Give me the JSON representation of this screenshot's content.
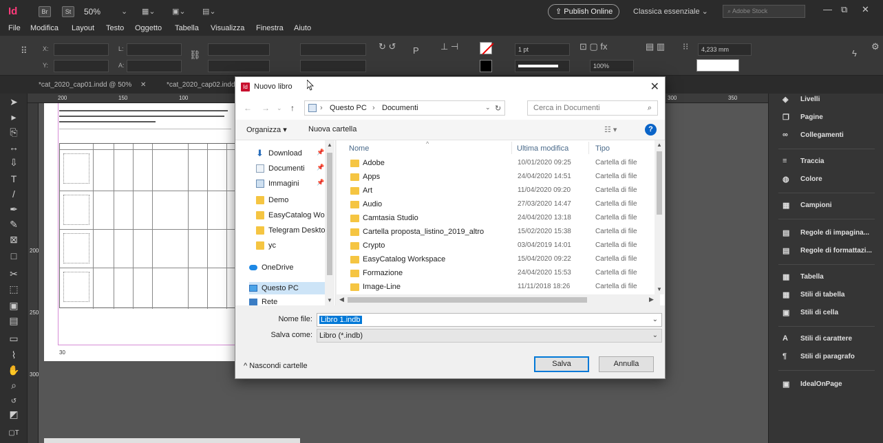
{
  "titlebar": {
    "br_label": "Br",
    "st_label": "St",
    "zoom": "50%",
    "publish_label": "Publish Online",
    "workspace": "Classica essenziale",
    "stock_placeholder": "Adobe Stock"
  },
  "menu": [
    "File",
    "Modifica",
    "Layout",
    "Testo",
    "Oggetto",
    "Tabella",
    "Visualizza",
    "Finestra",
    "Aiuto"
  ],
  "control": {
    "x_label": "X:",
    "y_label": "Y:",
    "w_label": "L:",
    "h_label": "A:",
    "stroke_weight": "1 pt",
    "zoom_percent": "100%",
    "size_value": "4,233 mm"
  },
  "doc_tabs": [
    "*cat_2020_cap01.indd @ 50%",
    "*cat_2020_cap02.indd"
  ],
  "ruler": {
    "h_ticks": [
      "200",
      "150",
      "100",
      "300",
      "350"
    ],
    "v_ticks": [
      "200",
      "250",
      "300"
    ]
  },
  "page_numbers": [
    "30"
  ],
  "right_panel": [
    {
      "label": "Livelli",
      "icon": "layers-icon"
    },
    {
      "label": "Pagine",
      "icon": "pages-icon"
    },
    {
      "label": "Collegamenti",
      "icon": "links-icon"
    },
    {
      "label": "Traccia",
      "icon": "stroke-icon"
    },
    {
      "label": "Colore",
      "icon": "color-icon"
    },
    {
      "label": "Campioni",
      "icon": "swatches-icon"
    },
    {
      "label": "Regole di impagina...",
      "icon": "layout-rules-icon"
    },
    {
      "label": "Regole di formattazi...",
      "icon": "format-rules-icon"
    },
    {
      "label": "Tabella",
      "icon": "table-icon"
    },
    {
      "label": "Stili di tabella",
      "icon": "table-styles-icon"
    },
    {
      "label": "Stili di cella",
      "icon": "cell-styles-icon"
    },
    {
      "label": "Stili di carattere",
      "icon": "char-styles-icon"
    },
    {
      "label": "Stili di paragrafo",
      "icon": "para-styles-icon"
    },
    {
      "label": "IdealOnPage",
      "icon": "plugin-icon"
    }
  ],
  "dialog": {
    "title": "Nuovo libro",
    "icon_label": "Id",
    "breadcrumb": [
      "Questo PC",
      "Documenti"
    ],
    "search_placeholder": "Cerca in Documenti",
    "organize_label": "Organizza",
    "new_folder_label": "Nuova cartella",
    "nav_items": [
      {
        "label": "Download",
        "pinned": true,
        "icon": "download-icon"
      },
      {
        "label": "Documenti",
        "pinned": true,
        "icon": "documents-icon"
      },
      {
        "label": "Immagini",
        "pinned": true,
        "icon": "images-icon"
      },
      {
        "label": "Demo",
        "pinned": false,
        "icon": "folder-icon"
      },
      {
        "label": "EasyCatalog Wo",
        "pinned": false,
        "icon": "folder-icon"
      },
      {
        "label": "Telegram Deskto",
        "pinned": false,
        "icon": "folder-icon"
      },
      {
        "label": "yc",
        "pinned": false,
        "icon": "folder-icon"
      },
      {
        "label": "OneDrive",
        "pinned": false,
        "icon": "onedrive-icon"
      },
      {
        "label": "Questo PC",
        "pinned": false,
        "icon": "pc-icon",
        "selected": true
      },
      {
        "label": "Rete",
        "pinned": false,
        "icon": "network-icon"
      }
    ],
    "columns": {
      "name": "Nome",
      "modified": "Ultima modifica",
      "type": "Tipo"
    },
    "files": [
      {
        "name": "Adobe",
        "date": "10/01/2020 09:25",
        "type": "Cartella di file"
      },
      {
        "name": "Apps",
        "date": "24/04/2020 14:51",
        "type": "Cartella di file"
      },
      {
        "name": "Art",
        "date": "11/04/2020 09:20",
        "type": "Cartella di file"
      },
      {
        "name": "Audio",
        "date": "27/03/2020 14:47",
        "type": "Cartella di file"
      },
      {
        "name": "Camtasia Studio",
        "date": "24/04/2020 13:18",
        "type": "Cartella di file"
      },
      {
        "name": "Cartella proposta_listino_2019_altro",
        "date": "15/02/2020 15:38",
        "type": "Cartella di file"
      },
      {
        "name": "Crypto",
        "date": "03/04/2019 14:01",
        "type": "Cartella di file"
      },
      {
        "name": "EasyCatalog Workspace",
        "date": "15/04/2020 09:22",
        "type": "Cartella di file"
      },
      {
        "name": "Formazione",
        "date": "24/04/2020 15:53",
        "type": "Cartella di file"
      },
      {
        "name": "Image-Line",
        "date": "11/11/2018 18:26",
        "type": "Cartella di file"
      }
    ],
    "filename_label": "Nome file:",
    "filename_value": "Libro 1.indb",
    "savetype_label": "Salva come:",
    "savetype_value": "Libro (*.indb)",
    "hide_folders_label": "Nascondi cartelle",
    "save_label": "Salva",
    "cancel_label": "Annulla"
  }
}
